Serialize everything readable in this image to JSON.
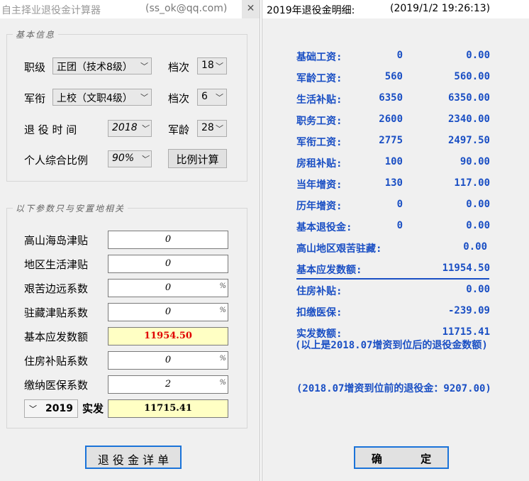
{
  "calculator": {
    "title": "自主择业退役金计算器",
    "contact": "(ss_ok@qq.com)",
    "basic_legend": "基本信息",
    "rank_label": "职级",
    "rank_value": "正团（技术8级）",
    "grade_label_1": "档次",
    "grade_value_1": "18",
    "military_rank_label": "军衔",
    "military_rank_value": "上校（文职4级）",
    "grade_label_2": "档次",
    "grade_value_2": "6",
    "retire_time_label": "退 役 时 间",
    "retire_time_value": "2018",
    "military_age_label": "军龄",
    "military_age_value": "28",
    "ratio_label": "个人综合比例",
    "ratio_value": "90%",
    "ratio_button": "比例计算",
    "location_legend": "以下参数只与安置地相关",
    "fields": [
      {
        "label": "高山海岛津贴",
        "value": "0",
        "pct": ""
      },
      {
        "label": "地区生活津贴",
        "value": "0",
        "pct": ""
      },
      {
        "label": "艰苦边远系数",
        "value": "0",
        "pct": "%"
      },
      {
        "label": "驻藏津贴系数",
        "value": "0",
        "pct": "%"
      },
      {
        "label": "基本应发数额",
        "value": "11954.50",
        "pct": ""
      },
      {
        "label": "住房补贴系数",
        "value": "0",
        "pct": "%"
      },
      {
        "label": "缴纳医保系数",
        "value": "2",
        "pct": "%"
      }
    ],
    "year_value": "2019",
    "actual_label": "实发",
    "actual_value": "11715.41",
    "detail_button": "退 役 金 详 单",
    "accent_red": "#e00000"
  },
  "detail": {
    "title": "2019年退役金明细:",
    "timestamp": "(2019/1/2 19:26:13)",
    "rows": [
      {
        "label": "基础工资:",
        "v1": "0",
        "v2": "0.00"
      },
      {
        "label": "军龄工资:",
        "v1": "560",
        "v2": "560.00"
      },
      {
        "label": "生活补贴:",
        "v1": "6350",
        "v2": "6350.00"
      },
      {
        "label": "职务工资:",
        "v1": "2600",
        "v2": "2340.00"
      },
      {
        "label": "军衔工资:",
        "v1": "2775",
        "v2": "2497.50"
      },
      {
        "label": "房租补贴:",
        "v1": "100",
        "v2": "90.00"
      },
      {
        "label": "当年增资:",
        "v1": "130",
        "v2": "117.00"
      },
      {
        "label": "历年增资:",
        "v1": "0",
        "v2": "0.00"
      },
      {
        "label": "基本退役金:",
        "v1": "0",
        "v2": "0.00"
      },
      {
        "label": "高山地区艰苦驻藏:",
        "v1": "",
        "v2": "0.00"
      },
      {
        "label": "基本应发数额:",
        "v1": "",
        "v2": "11954.50"
      }
    ],
    "housing_label": "住房补贴:",
    "housing_value": "0.00",
    "medical_label": "扣缴医保:",
    "medical_value": "-239.09",
    "actual_label": "实发数额:",
    "actual_value": "11715.41",
    "note_after": "(以上是2018.07增资到位后的退役金数额)",
    "note_before": "(2018.07增资到位前的退役金：9207.00)",
    "ok_button": "确      定",
    "accent_blue": "#1a4fc4"
  }
}
